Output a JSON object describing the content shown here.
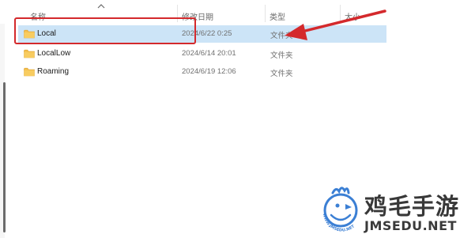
{
  "columns": {
    "name": "名称",
    "modified": "修改日期",
    "type": "类型",
    "size": "大小"
  },
  "rows": [
    {
      "name": "Local",
      "modified": "2024/6/22 0:25",
      "type": "文件夹",
      "selected": true
    },
    {
      "name": "LocalLow",
      "modified": "2024/6/14 20:01",
      "type": "文件夹",
      "selected": false
    },
    {
      "name": "Roaming",
      "modified": "2024/6/19 12:06",
      "type": "文件夹",
      "selected": false
    }
  ],
  "icons": {
    "folder": "folder-icon",
    "sort": "chevron-up-icon",
    "annotation_arrow": "red-arrow"
  },
  "colors": {
    "selection": "#cce4f7",
    "annotation": "#d4292c",
    "folder": "#f5c04e"
  },
  "watermark": {
    "title": "鸡毛手游",
    "url": "JMSEDU.NET",
    "logo_text": "WWW.JMSEDU.NET"
  }
}
